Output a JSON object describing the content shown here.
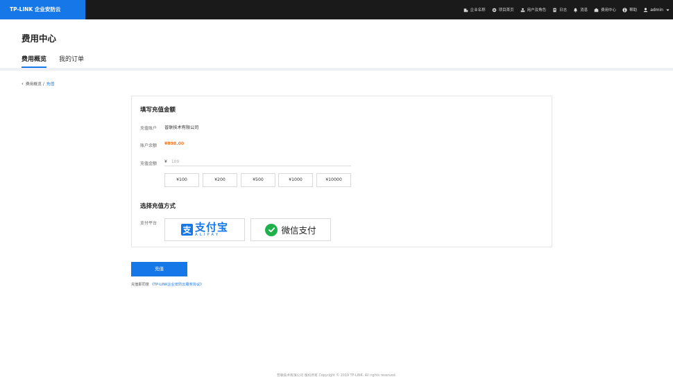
{
  "topbar": {
    "brand": "TP-LINK 企业安防云",
    "nav": [
      {
        "icon": "company-icon",
        "label": "企业名称"
      },
      {
        "icon": "project-icon",
        "label": "项目首页"
      },
      {
        "icon": "users-icon",
        "label": "用户及角色"
      },
      {
        "icon": "log-icon",
        "label": "日志"
      },
      {
        "icon": "bell-icon",
        "label": "消息"
      },
      {
        "icon": "billing-icon",
        "label": "费用中心"
      },
      {
        "icon": "help-icon",
        "label": "帮助"
      }
    ],
    "user": "admin"
  },
  "page": {
    "title": "费用中心",
    "tabs": [
      {
        "label": "费用概览",
        "active": true
      },
      {
        "label": "我的订单",
        "active": false
      }
    ]
  },
  "breadcrumb": {
    "back_icon": "chevron-left-icon",
    "parent": "费用概览 /",
    "current": "充值"
  },
  "form": {
    "amount_section_title": "填写充值金额",
    "account_label": "充值账户",
    "account_value": "普联技术有限公司",
    "balance_label": "账户余额",
    "balance_value": "¥898.00",
    "amount_label": "充值金额",
    "currency": "¥",
    "amount_placeholder": "100",
    "preset_amounts": [
      "¥100",
      "¥200",
      "¥500",
      "¥1000",
      "¥10000"
    ],
    "method_section_title": "选择充值方式",
    "platform_label": "支付平台",
    "alipay": {
      "cn": "支付宝",
      "en": "ALIPAY",
      "mark": "支"
    },
    "wechat": {
      "cn": "微信支付"
    }
  },
  "submit_label": "充值",
  "agreement": {
    "prefix": "充值即同意",
    "link": "《TP-LINK企业安防云服务协议》"
  },
  "footer": "普联技术有限公司 版权所有 Copyright © 2019 TP-LINK. All rights reserved.",
  "colors": {
    "brand_blue": "#1677e8",
    "topbar_bg": "#1a1a1a",
    "balance_orange": "#f5791f",
    "wechat_green": "#20b14c"
  }
}
